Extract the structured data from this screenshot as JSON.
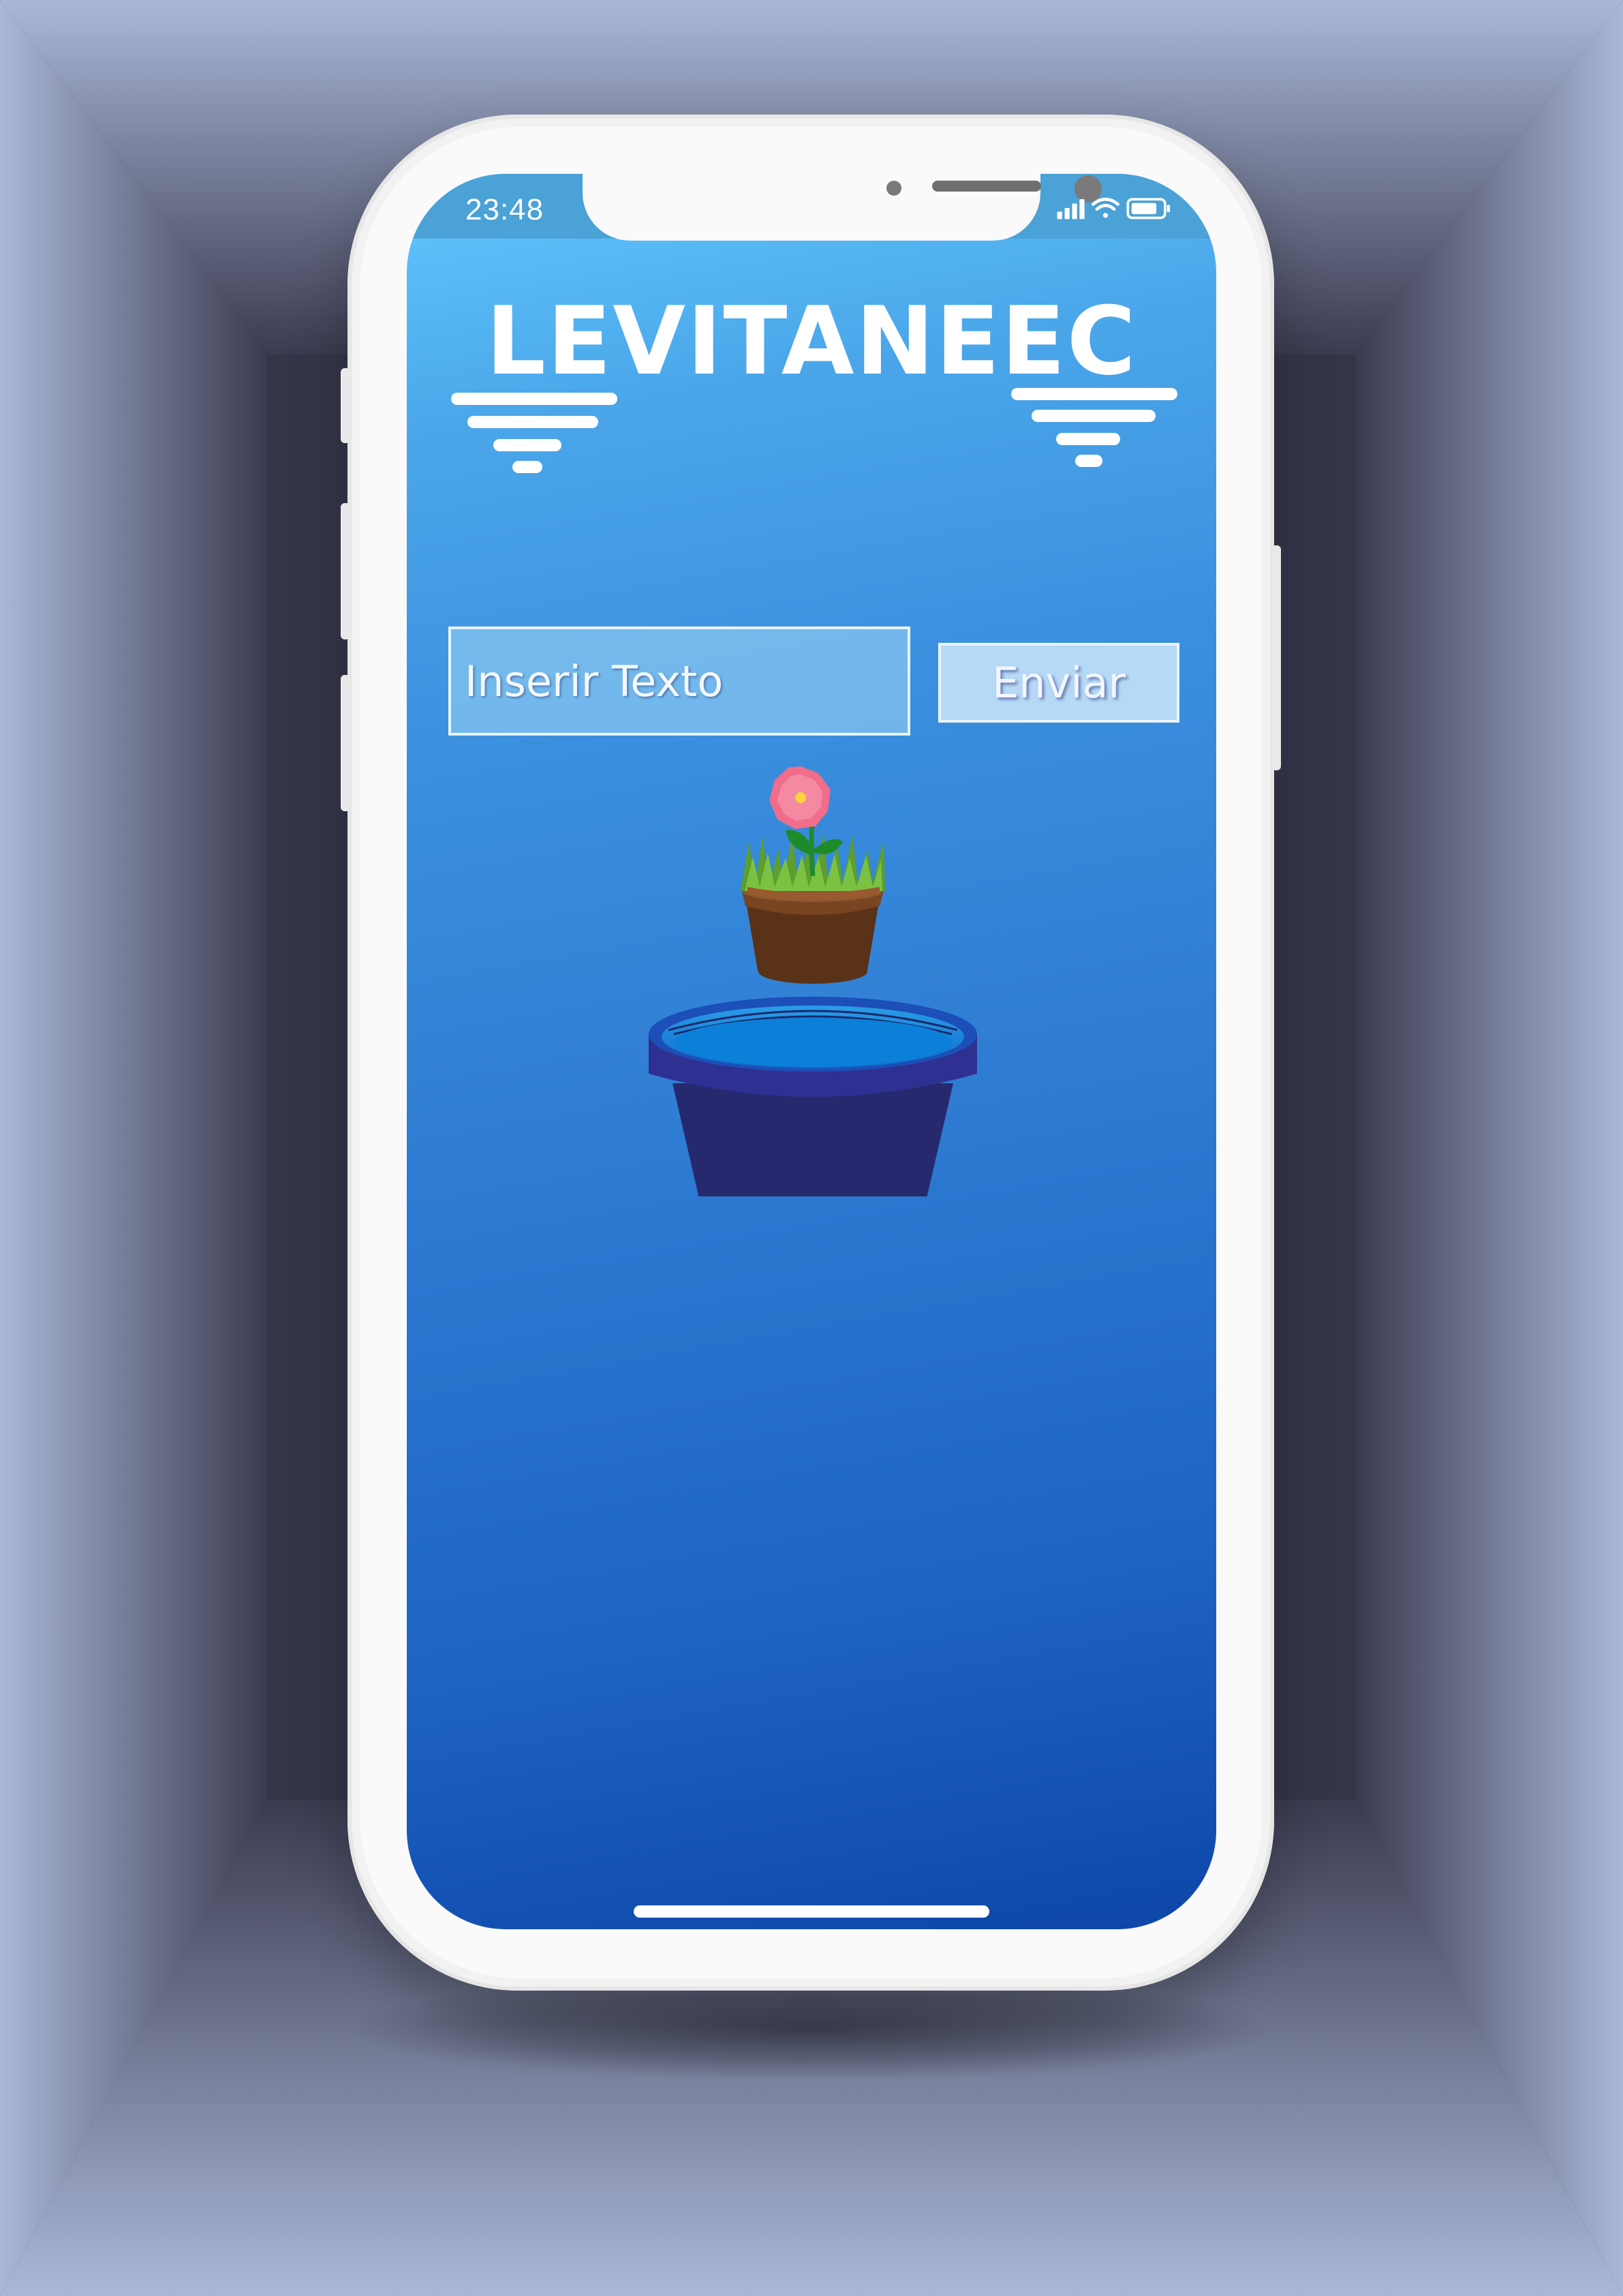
{
  "status_bar": {
    "time": "23:48",
    "icons": [
      "signal-icon",
      "wifi-icon",
      "battery-icon"
    ]
  },
  "app": {
    "title": "LEVITANEEC",
    "input": {
      "placeholder": "Inserir Texto",
      "value": ""
    },
    "send_button": {
      "label": "Enviar"
    }
  },
  "colors": {
    "screen_top": "#62c8ff",
    "screen_bottom": "#0c46a8",
    "pot_blue": "#26296e",
    "pot_rim": "#2e3192",
    "water": "#1a7fd6",
    "flower_pink": "#f06d8c",
    "clay_pot": "#5a3218",
    "grass": "#6ab03a"
  }
}
